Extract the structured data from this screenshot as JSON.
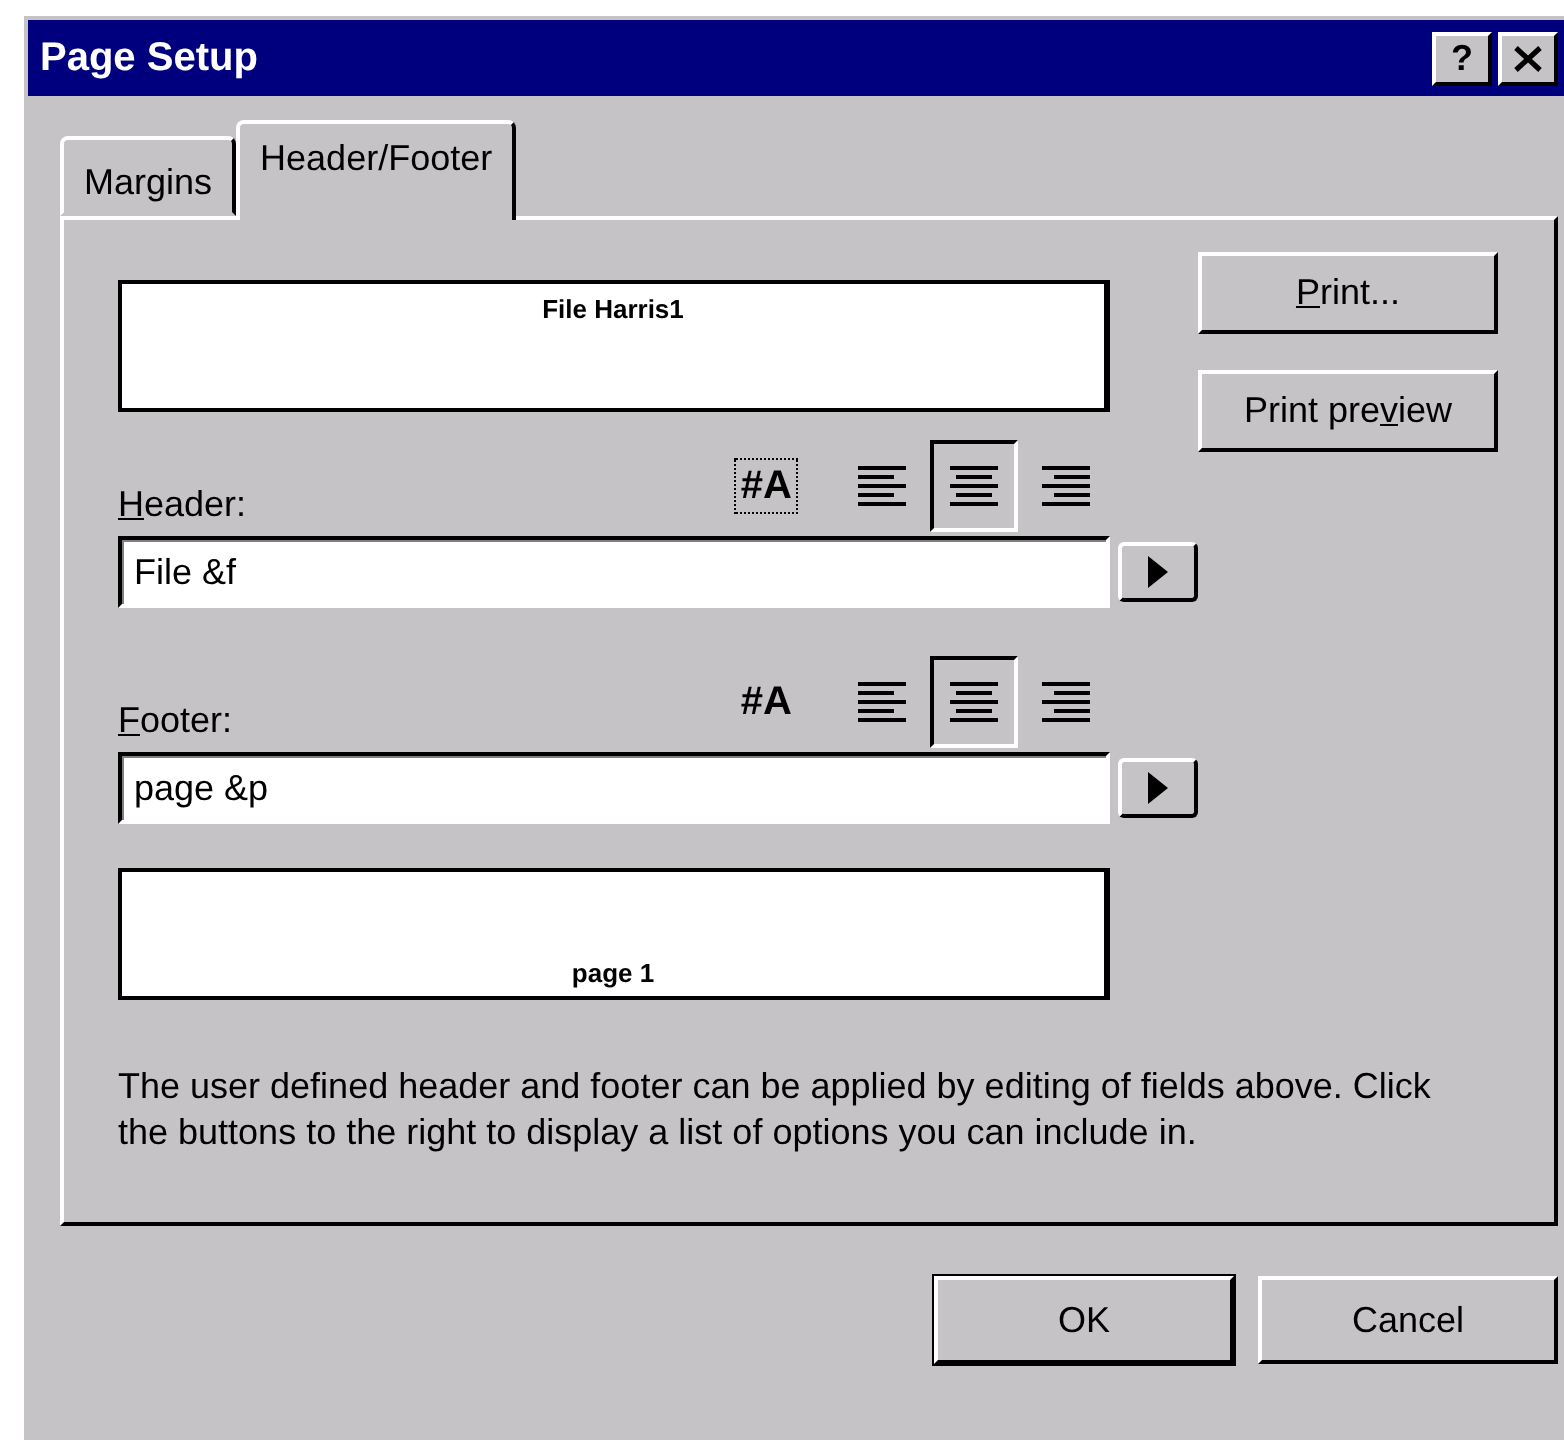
{
  "window": {
    "title": "Page Setup",
    "title_buttons": [
      {
        "kind": "help",
        "label": "?"
      },
      {
        "kind": "close"
      }
    ]
  },
  "tabs": [
    {
      "label": "Margins",
      "selected": false
    },
    {
      "label": "Header/Footer",
      "selected": true
    }
  ],
  "header": {
    "preview": "File Harris1",
    "label": [
      {
        "text": "H",
        "underline": true
      },
      {
        "text": "eader:",
        "underline": false
      }
    ],
    "value": "File &f",
    "font_focused": true,
    "font_label": "#A",
    "align": [
      {
        "kind": "left",
        "selected": false
      },
      {
        "kind": "center",
        "selected": true
      },
      {
        "kind": "right",
        "selected": false
      }
    ]
  },
  "footer": {
    "preview": "page 1",
    "label": [
      {
        "text": "F",
        "underline": true
      },
      {
        "text": "ooter:",
        "underline": false
      }
    ],
    "value": "page &p",
    "font_focused": false,
    "font_label": "#A",
    "align": [
      {
        "kind": "left",
        "selected": false
      },
      {
        "kind": "center",
        "selected": true
      },
      {
        "kind": "right",
        "selected": false
      }
    ]
  },
  "side_buttons": [
    {
      "label": [
        {
          "text": "P",
          "underline": true
        },
        {
          "text": "rint...",
          "underline": false
        }
      ]
    },
    {
      "label": [
        {
          "text": "Print pre",
          "underline": false
        },
        {
          "text": "v",
          "underline": true
        },
        {
          "text": "iew",
          "underline": false
        }
      ]
    }
  ],
  "description": "The user defined header and footer can be applied by editing of fields above. Click the buttons to the right to display a list of options you can include in.",
  "buttons": [
    {
      "label": "OK",
      "default": true
    },
    {
      "label": "Cancel",
      "default": false
    }
  ]
}
